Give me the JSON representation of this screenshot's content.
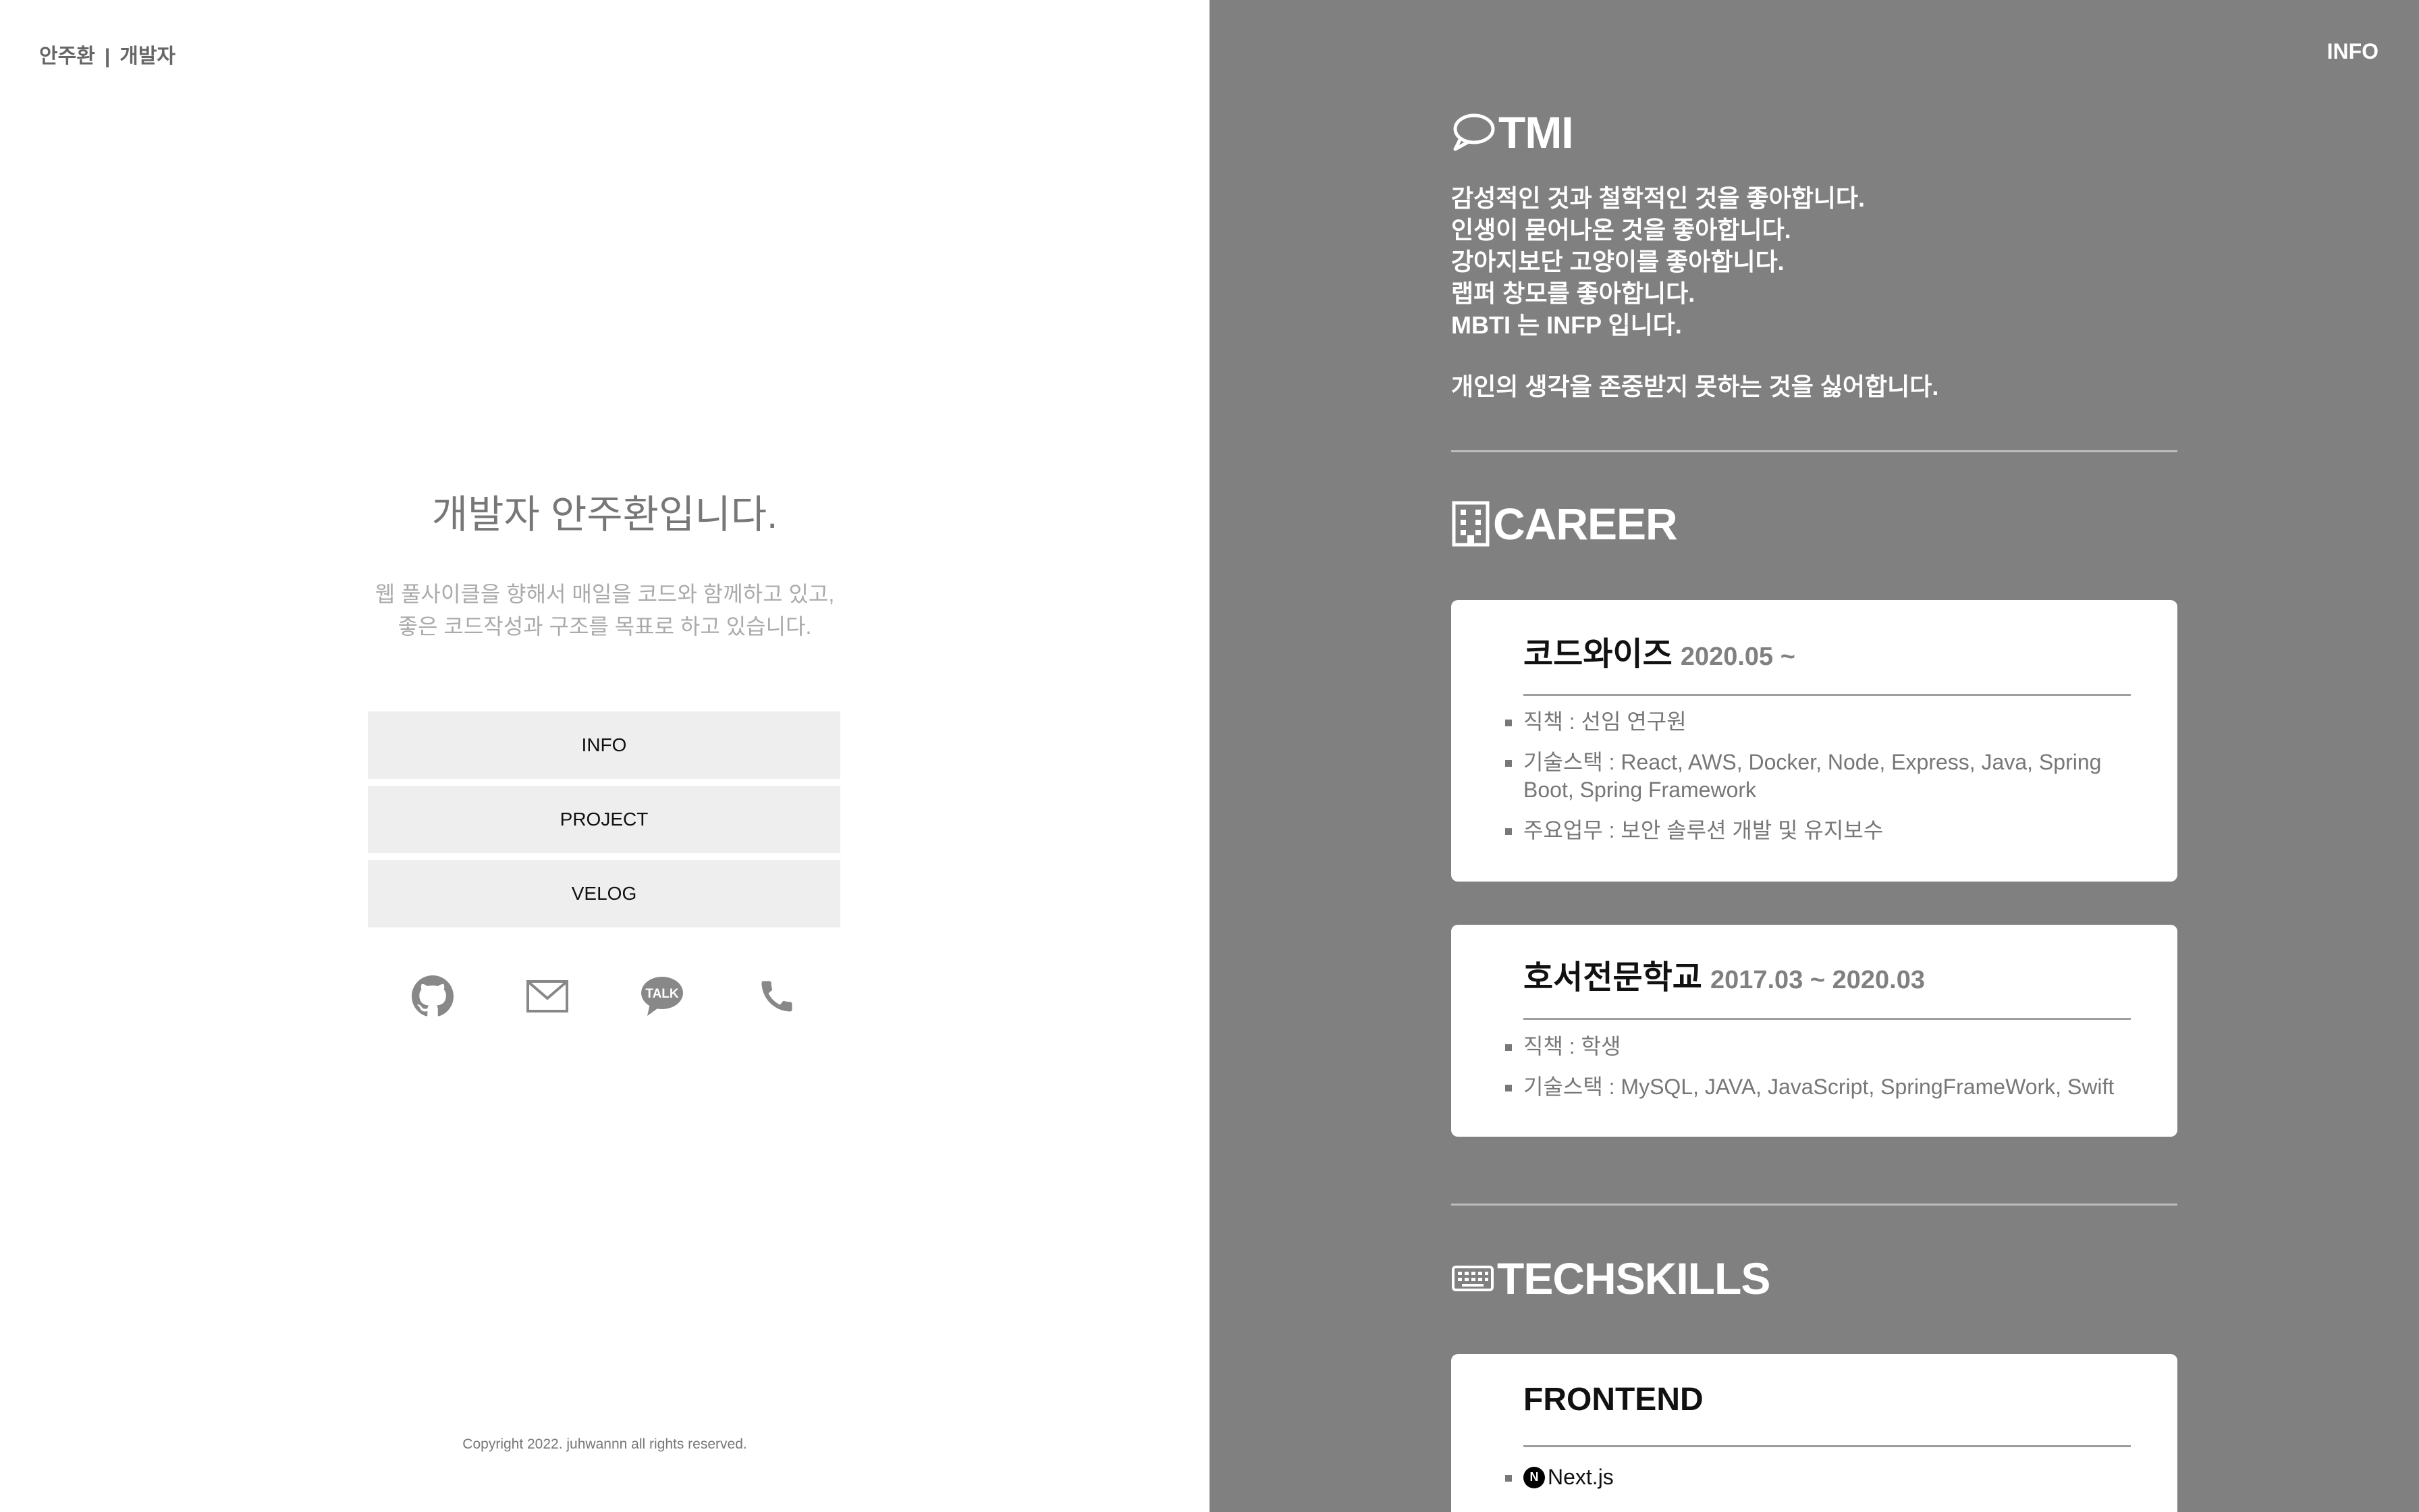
{
  "header": {
    "name": "안주환",
    "separator": "|",
    "role": "개발자"
  },
  "hero": {
    "title": "개발자 안주환입니다.",
    "desc_line1": "웹 풀사이클을 향해서 매일을 코드와 함께하고 있고,",
    "desc_line2": "좋은 코드작성과 구조를 목표로 하고 있습니다."
  },
  "menu": [
    {
      "label": "INFO"
    },
    {
      "label": "PROJECT"
    },
    {
      "label": "VELOG"
    }
  ],
  "social": [
    {
      "icon": "github-icon"
    },
    {
      "icon": "mail-icon"
    },
    {
      "icon": "kakaotalk-icon",
      "text": "TALK"
    },
    {
      "icon": "phone-icon"
    }
  ],
  "footer": {
    "copyright": "Copyright 2022. juhwannn all rights reserved."
  },
  "right_nav": {
    "label": "INFO"
  },
  "tmi": {
    "title": "TMI",
    "icon": "speech-bubble-icon",
    "lines": [
      "감성적인 것과 철학적인 것을 좋아합니다.",
      "인생이 묻어나온 것을 좋아합니다.",
      "강아지보단 고양이를 좋아합니다.",
      "랩퍼 창모를 좋아합니다.",
      "MBTI 는 INFP 입니다."
    ],
    "last_line": "개인의 생각을 존중받지 못하는 것을 싫어합니다."
  },
  "career": {
    "title": "CAREER",
    "icon": "building-icon",
    "items": [
      {
        "name": "코드와이즈",
        "period": "2020.05 ~",
        "details": [
          "직책 : 선임 연구원",
          "기술스택 : React, AWS, Docker, Node, Express, Java, Spring Boot, Spring Framework",
          "주요업무 : 보안 솔루션 개발 및 유지보수"
        ]
      },
      {
        "name": "호서전문학교",
        "period": "2017.03 ~ 2020.03",
        "details": [
          "직책 : 학생",
          "기술스택 : MySQL, JAVA, JavaScript, SpringFrameWork, Swift"
        ]
      }
    ]
  },
  "techskills": {
    "title": "TECHSKILLS",
    "icon": "keyboard-icon",
    "frontend": {
      "title": "FRONTEND",
      "items": [
        {
          "icon": "nextjs-icon",
          "icon_letter": "N",
          "label": "Next.js"
        }
      ]
    }
  },
  "colors": {
    "panel_bg": "#808080",
    "button_bg": "#eeeeee",
    "text_muted": "#777777"
  }
}
